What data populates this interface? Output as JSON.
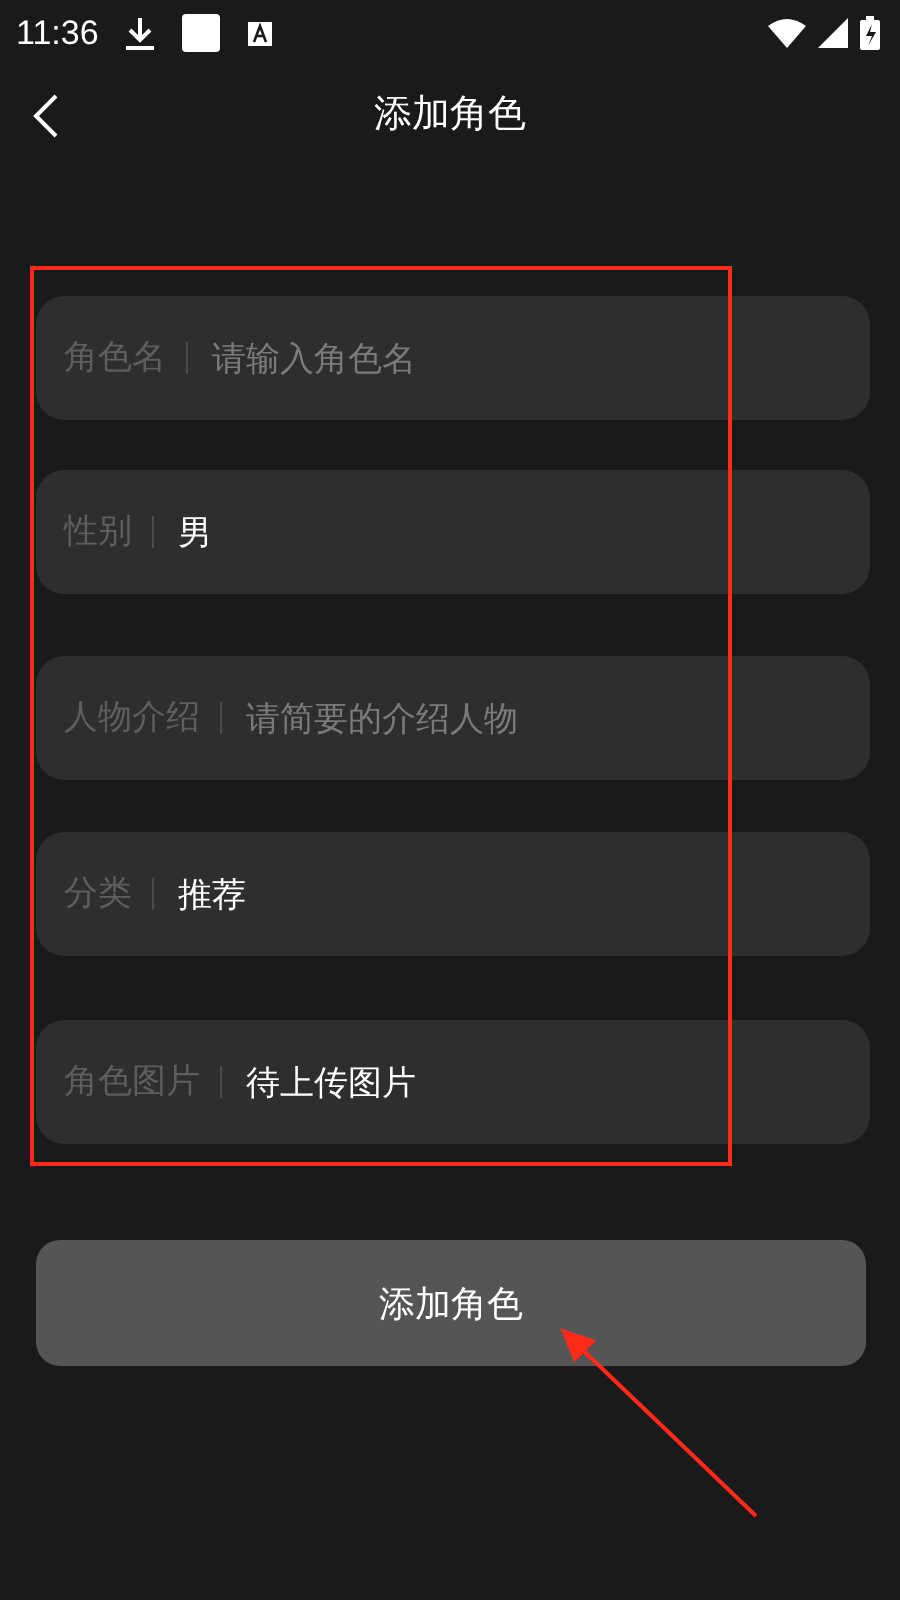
{
  "status_bar": {
    "time": "11:36"
  },
  "header": {
    "title": "添加角色"
  },
  "fields": [
    {
      "label": "角色名",
      "placeholder": "请输入角色名"
    },
    {
      "label": "性别",
      "value": "男"
    },
    {
      "label": "人物介绍",
      "placeholder": "请简要的介绍人物"
    },
    {
      "label": "分类",
      "value": "推荐"
    },
    {
      "label": "角色图片",
      "value": "待上传图片"
    }
  ],
  "submit_button": {
    "label": "添加角色"
  }
}
